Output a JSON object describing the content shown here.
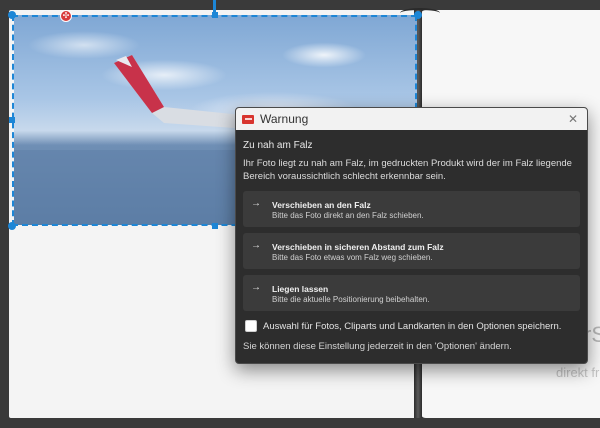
{
  "dialog": {
    "title": "Warnung",
    "heading": "Zu nah am Falz",
    "message": "Ihr Foto liegt zu nah am Falz, im gedruckten Produkt wird der im Falz liegende Bereich voraussichtlich schlecht erkennbar sein.",
    "options": [
      {
        "title": "Verschieben an den Falz",
        "description": "Bitte das Foto direkt an den Falz schieben."
      },
      {
        "title": "Verschieben in sicheren Abstand zum Falz",
        "description": "Bitte das Foto etwas vom Falz weg schieben."
      },
      {
        "title": "Liegen lassen",
        "description": "Bitte die aktuelle Positionierung beibehalten."
      }
    ],
    "checkbox_label": "Auswahl für Fotos, Cliparts und Landkarten in den Optionen speichern.",
    "checkbox_checked": false,
    "footer": "Sie können diese Einstellung jederzeit in den 'Optionen' ändern.",
    "close_icon": "close-icon",
    "arrow_icon": "arrow-right-icon"
  },
  "canvas": {
    "right_page_text_1": "rSa",
    "right_page_text_2": "kann direkt fr"
  },
  "colors": {
    "selection": "#1d86d6",
    "dialog_bg": "#2d2d2d",
    "option_bg": "#3b3b3b",
    "brand": "#d8352f"
  }
}
